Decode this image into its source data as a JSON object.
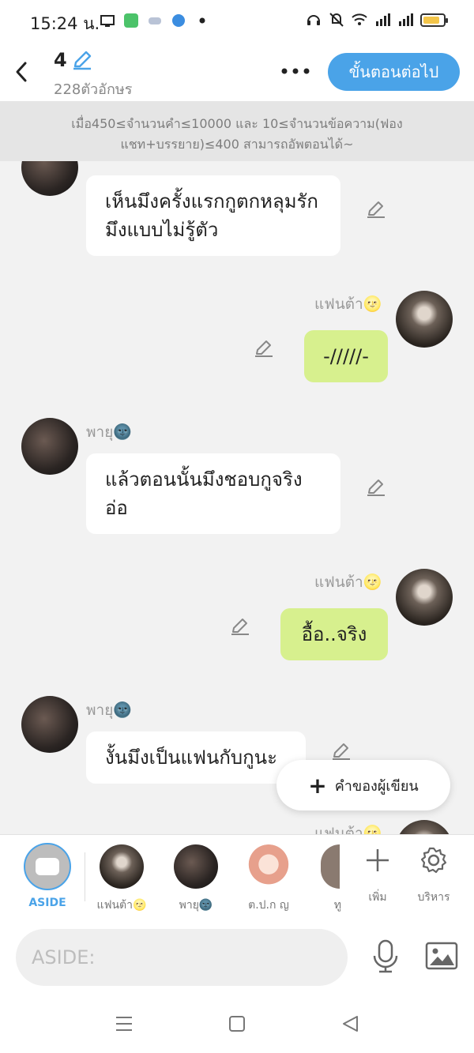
{
  "status": {
    "time": "15:24 น.",
    "battery_level": 0.85
  },
  "header": {
    "title": "4",
    "char_count": "228ตัวอักษร",
    "next_label": "ขั้นตอนต่อไป"
  },
  "notice": {
    "text": "เมื่อ450≤จำนวนคำ≤10000 และ 10≤จำนวนข้อความ(ฟองแชท+บรรยาย)≤400 สามารถอัพตอนได้~"
  },
  "messages": [
    {
      "side": "left",
      "text": "เห็นมึงครั้งแรกกูตกหลุมรักมึงแบบไม่รู้ตัว"
    },
    {
      "side": "right",
      "name": "แฟนต้า🌝",
      "text": "-/////-"
    },
    {
      "side": "left",
      "name": "พายุ🌚",
      "text": "แล้วตอนนั้นมึงชอบกูจริงอ่อ"
    },
    {
      "side": "right",
      "name": "แฟนต้า🌝",
      "text": "อื้อ..จริง"
    },
    {
      "side": "left",
      "name": "พายุ🌚",
      "text": "งั้นมึงเป็นแฟนกับกูนะ"
    },
    {
      "side": "right",
      "name": "แฟนต้า🌝",
      "text": ""
    }
  ],
  "fab": {
    "label": "คำของผู้เขียน"
  },
  "rolebar": {
    "aside_label": "ASIDE",
    "roles": [
      "แฟนต้า🌝",
      "พายุ🌚",
      "ต.ป.ก ญ",
      "ทู"
    ],
    "add_label": "เพิ่ม",
    "manage_label": "บริหาร"
  },
  "input": {
    "placeholder": "ASIDE:"
  },
  "icons": [
    "back-icon",
    "edit-pencil-icon",
    "more-icon",
    "plus-icon",
    "gear-icon",
    "microphone-icon",
    "image-icon",
    "nav-menu-icon",
    "nav-home-icon",
    "nav-back-icon"
  ]
}
